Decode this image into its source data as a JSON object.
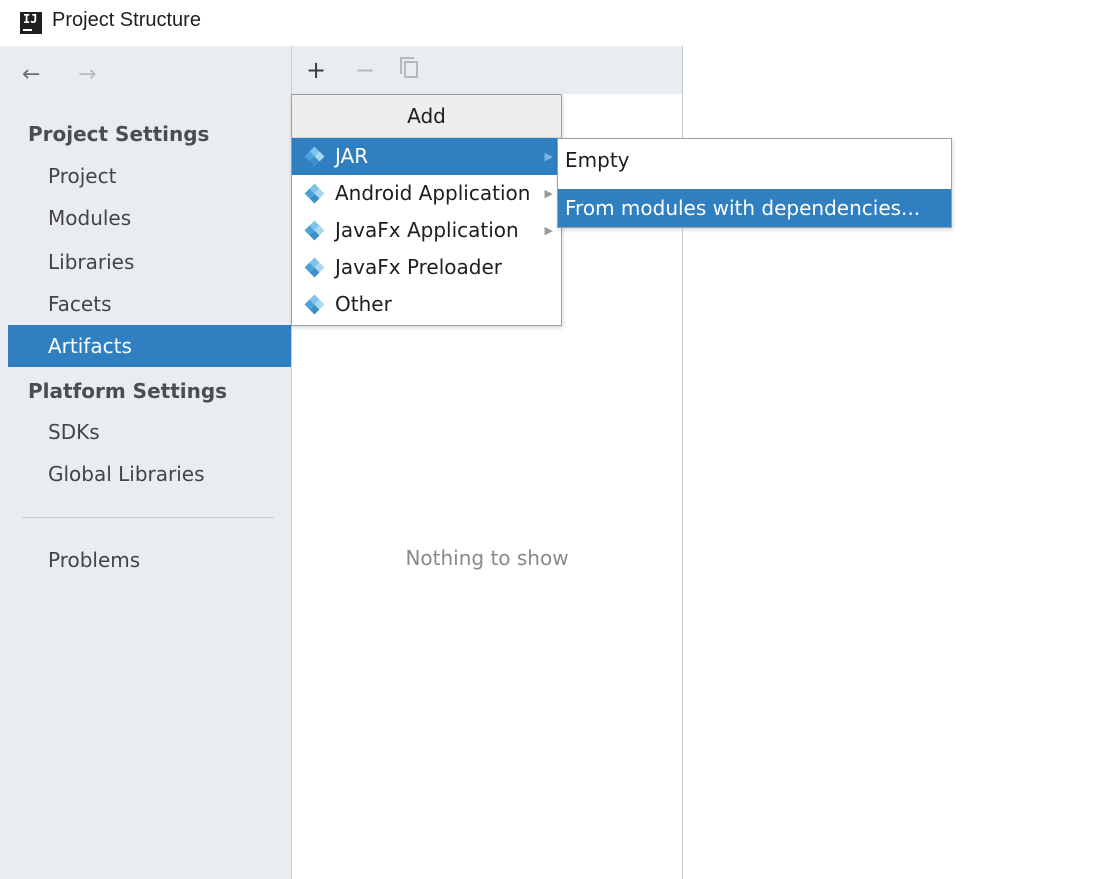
{
  "window": {
    "title": "Project Structure",
    "logo_text": "IJ"
  },
  "nav": {
    "back_icon": "←",
    "forward_icon": "→"
  },
  "sidebar": {
    "project_settings_header": "Project Settings",
    "project_items": [
      {
        "label": "Project"
      },
      {
        "label": "Modules"
      },
      {
        "label": "Libraries"
      },
      {
        "label": "Facets"
      },
      {
        "label": "Artifacts",
        "selected": true
      }
    ],
    "platform_settings_header": "Platform Settings",
    "platform_items": [
      {
        "label": "SDKs"
      },
      {
        "label": "Global Libraries"
      }
    ],
    "problems_label": "Problems"
  },
  "toolbar": {
    "add_icon": "+",
    "remove_icon": "−",
    "copy_icon": "copy-icon"
  },
  "middle": {
    "empty_text": "Nothing to show"
  },
  "add_menu": {
    "header": "Add",
    "items": [
      {
        "label": "JAR",
        "has_submenu": true,
        "highlighted": true
      },
      {
        "label": "Android Application",
        "has_submenu": true
      },
      {
        "label": "JavaFx Application",
        "has_submenu": true
      },
      {
        "label": "JavaFx Preloader",
        "has_submenu": false
      },
      {
        "label": "Other",
        "has_submenu": false
      }
    ],
    "submenu_arrow": "▶"
  },
  "jar_submenu": {
    "items": [
      {
        "label": "Empty"
      },
      {
        "label": "From modules with dependencies...",
        "highlighted": true
      }
    ]
  },
  "colors": {
    "selection": "#2f7fc1",
    "sidebar_bg": "#e9edf2",
    "border": "#c9ced4"
  }
}
